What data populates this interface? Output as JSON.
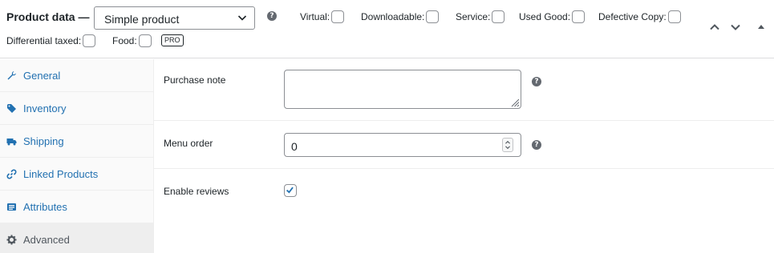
{
  "header": {
    "title": "Product data —",
    "product_type": "Simple product",
    "options": [
      {
        "label": "Virtual:"
      },
      {
        "label": "Downloadable:"
      },
      {
        "label": "Service:"
      },
      {
        "label": "Used Good:"
      },
      {
        "label": "Defective Copy:"
      },
      {
        "label": "Differential taxed:"
      },
      {
        "label": "Food:"
      }
    ],
    "pro_badge": "PRO",
    "help_glyph": "?"
  },
  "sidebar": {
    "items": [
      {
        "label": "General",
        "icon": "wrench-icon"
      },
      {
        "label": "Inventory",
        "icon": "tag-icon"
      },
      {
        "label": "Shipping",
        "icon": "truck-icon"
      },
      {
        "label": "Linked Products",
        "icon": "link-icon"
      },
      {
        "label": "Attributes",
        "icon": "list-icon"
      },
      {
        "label": "Advanced",
        "icon": "gear-icon"
      }
    ],
    "active": "Advanced"
  },
  "advanced": {
    "purchase_note_label": "Purchase note",
    "purchase_note_value": "",
    "menu_order_label": "Menu order",
    "menu_order_value": "0",
    "enable_reviews_label": "Enable reviews",
    "enable_reviews_checked": true
  },
  "colors": {
    "link": "#2271b1",
    "text": "#1d2327",
    "active_tab_bg": "#eeeeee"
  }
}
